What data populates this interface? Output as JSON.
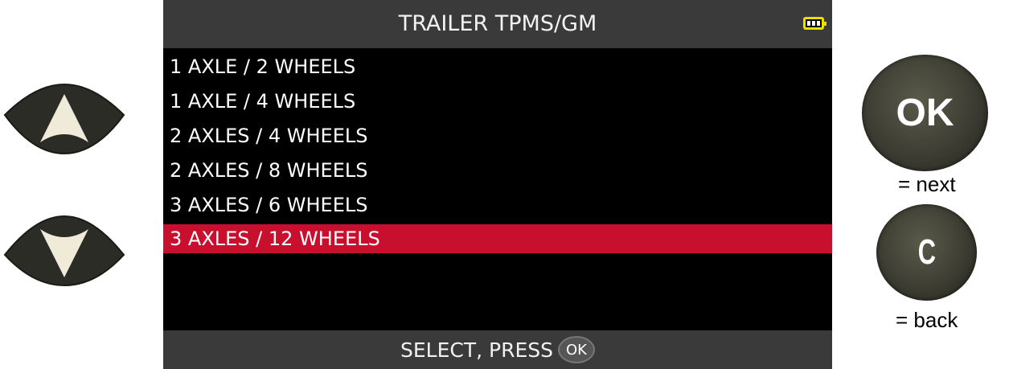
{
  "screen": {
    "title": "TRAILER TPMS/GM",
    "battery_level_fraction": 1.0,
    "menu_items": [
      {
        "label": "1 AXLE / 2 WHEELS",
        "selected": false
      },
      {
        "label": "1 AXLE / 4 WHEELS",
        "selected": false
      },
      {
        "label": "2 AXLES / 4 WHEELS",
        "selected": false
      },
      {
        "label": "2 AXLES / 8 WHEELS",
        "selected": false
      },
      {
        "label": "3 AXLES / 6 WHEELS",
        "selected": false
      },
      {
        "label": "3 AXLES / 12 WHEELS",
        "selected": true
      }
    ],
    "footer_text": "SELECT, PRESS",
    "footer_button": "OK"
  },
  "keys": {
    "up_icon": "arrow-up-icon",
    "down_icon": "arrow-down-icon",
    "ok_label": "OK",
    "ok_caption": "= next",
    "c_label": "C",
    "c_caption": "= back"
  },
  "colors": {
    "screen_bg": "#000000",
    "bar_bg": "#3a3a3a",
    "selection": "#c8102e",
    "battery": "#e9e000"
  }
}
